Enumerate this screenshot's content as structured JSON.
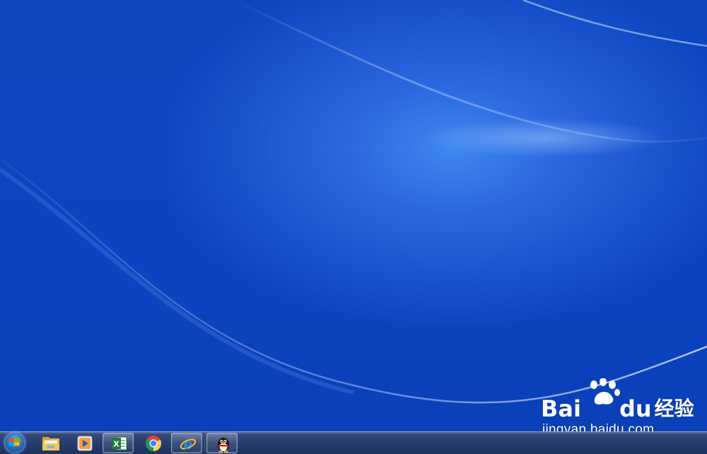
{
  "watermark": {
    "logo_bai": "Bai",
    "logo_du": "du",
    "logo_cn": "经验",
    "url": "jingyan.baidu.com"
  },
  "taskbar": {
    "start": {
      "icon": "windows-logo-icon"
    },
    "pinned": [
      {
        "name": "file-explorer",
        "icon": "folder-icon",
        "active": false
      },
      {
        "name": "media-player",
        "icon": "media-player-icon",
        "active": false
      },
      {
        "name": "excel",
        "icon": "excel-icon",
        "active": true
      },
      {
        "name": "chrome",
        "icon": "chrome-icon",
        "active": false
      },
      {
        "name": "internet-explorer",
        "icon": "ie-icon",
        "active": true
      },
      {
        "name": "qq",
        "icon": "qq-penguin-icon",
        "active": true
      }
    ]
  },
  "colors": {
    "desktop_blue": "#0b44c2",
    "highlight_blue": "#3f87f0",
    "taskbar": "#263b6c",
    "excel_green": "#1f7a3e",
    "ie_blue": "#1e90e8"
  }
}
